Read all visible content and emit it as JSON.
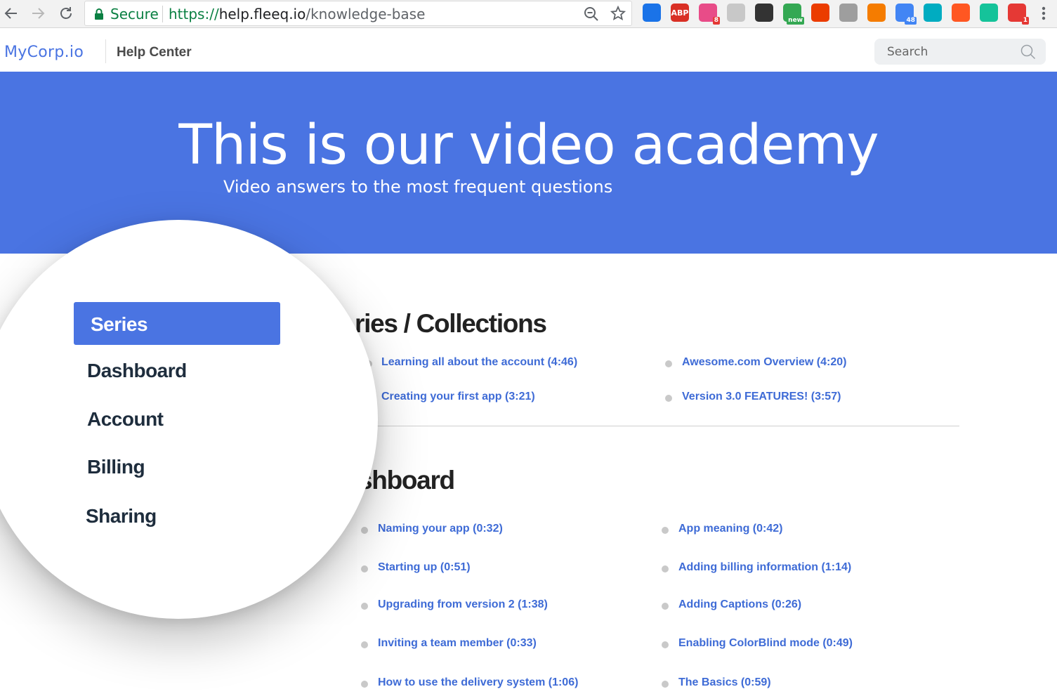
{
  "browser": {
    "secure_label": "Secure",
    "url_scheme": "https://",
    "url_host": "help.fleeq.io",
    "url_path": "/knowledge-base",
    "extensions": [
      {
        "name": "video-extension-icon",
        "color": "#1a73e8"
      },
      {
        "name": "adblock-icon",
        "label": "ABP",
        "color": "#d93025"
      },
      {
        "name": "mixmax-icon",
        "badge": "8",
        "color": "#e84c88"
      },
      {
        "name": "ghost-extension-icon",
        "color": "#c8c8c8"
      },
      {
        "name": "incognito-agent-icon",
        "color": "#333333"
      },
      {
        "name": "android-new-icon",
        "badge": "new",
        "color": "#34a853"
      },
      {
        "name": "office-icon",
        "color": "#eb3c00"
      },
      {
        "name": "hunter-icon",
        "color": "#9e9e9e"
      },
      {
        "name": "play-extension-icon",
        "color": "#f57c00"
      },
      {
        "name": "calendar-icon",
        "badge": "48",
        "color": "#4285f4"
      },
      {
        "name": "eye-extension-icon",
        "color": "#00acc1"
      },
      {
        "name": "translate-extension-icon",
        "color": "#ff5722"
      },
      {
        "name": "grammarly-icon",
        "color": "#15c39a"
      },
      {
        "name": "alert-extension-icon",
        "badge": "1",
        "color": "#e53935"
      }
    ]
  },
  "header": {
    "logo": "MyCorp.io",
    "section": "Help Center",
    "search_placeholder": "Search"
  },
  "hero": {
    "title": "This is our video academy",
    "subtitle": "Video answers to the most frequent questions"
  },
  "sections": [
    {
      "title": "ries / Collections",
      "videos": [
        "Learning all about the account (4:46)",
        "Awesome.com Overview (4:20)",
        "Creating your first app (3:21)",
        "Version 3.0 FEATURES! (3:57)"
      ]
    },
    {
      "title": "shboard",
      "videos": [
        "Naming your app (0:32)",
        "App meaning (0:42)",
        "Starting up (0:51)",
        "Adding billing information (1:14)",
        "Upgrading from version 2 (1:38)",
        "Adding Captions (0:26)",
        "Inviting a team member (0:33)",
        "Enabling ColorBlind mode (0:49)",
        "How to use the delivery system (1:06)",
        "The Basics (0:59)"
      ]
    }
  ],
  "categories": {
    "active_index": 0,
    "items": [
      "Series",
      "Dashboard",
      "Account",
      "Billing",
      "Sharing"
    ]
  },
  "colors": {
    "brand": "#4a74e2",
    "link": "#3e6bd6",
    "secure_green": "#0b8043"
  }
}
